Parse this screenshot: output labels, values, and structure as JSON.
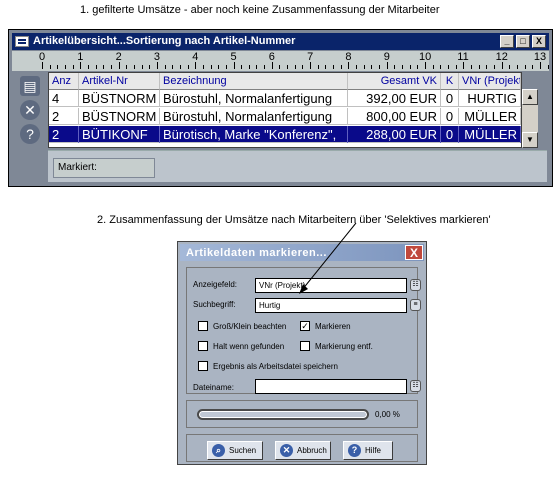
{
  "captions": {
    "top": "1.  gefilterte Umsätze - aber noch keine Zusammenfassung der Mitarbeiter",
    "bottom": "2. Zusammenfassung der Umsätze nach Mitarbeitern über 'Selektives markieren'"
  },
  "window": {
    "title": "Artikelübersicht...Sortierung nach Artikel-Nummer",
    "buttons": {
      "minimize": "_",
      "maximize": "□",
      "close": "X"
    },
    "ruler": [
      "0",
      "1",
      "2",
      "3",
      "4",
      "5",
      "6",
      "7",
      "8",
      "9",
      "10",
      "11",
      "12",
      "13"
    ],
    "sidebar_icons": [
      "printer-icon",
      "close-circle-icon",
      "help-circle-icon"
    ],
    "columns": [
      "Anz",
      "Artikel-Nr",
      "Bezeichnung",
      "Gesamt VK",
      "K",
      "VNr (Projekt"
    ],
    "rows": [
      {
        "anz": "4",
        "artikel": "BÜSTNORM",
        "bezeichnung": "Bürostuhl, Normalanfertigung",
        "gesamt": "392,00 EUR",
        "k": "0",
        "vnr": "HURTIG",
        "selected": false
      },
      {
        "anz": "2",
        "artikel": "BÜSTNORM",
        "bezeichnung": "Bürostuhl, Normalanfertigung",
        "gesamt": "800,00 EUR",
        "k": "0",
        "vnr": "MÜLLER",
        "selected": false
      },
      {
        "anz": "2",
        "artikel": "BÜTIKONF",
        "bezeichnung": "Bürotisch, Marke \"Konferenz\",",
        "gesamt": "288,00 EUR",
        "k": "0",
        "vnr": "MÜLLER",
        "selected": true
      }
    ],
    "mark_label": "Markiert:"
  },
  "dialog": {
    "title": "Artikeldaten markieren...",
    "close": "X",
    "anzeigefeld_label": "Anzeigefeld:",
    "anzeigefeld_value": "VNr (Projekt)",
    "suchbegriff_label": "Suchbegriff:",
    "suchbegriff_value": "Hurtig",
    "checkboxes": {
      "gross_klein": {
        "label": "Groß/Klein beachten",
        "checked": false
      },
      "markieren": {
        "label": "Markieren",
        "checked": true
      },
      "halt": {
        "label": "Halt wenn gefunden",
        "checked": false
      },
      "markierung_entf": {
        "label": "Markierung entf.",
        "checked": false
      },
      "ergebnis": {
        "label": "Ergebnis als Arbeitsdatei speichern",
        "checked": false
      }
    },
    "dateiname_label": "Dateiname:",
    "dateiname_value": "",
    "progress_text": "0,00 %",
    "progress": 0,
    "buttons": {
      "suchen": "Suchen",
      "abbruch": "Abbruch",
      "hilfe": "Hilfe"
    }
  },
  "colors": {
    "selection": "#0a0a8a",
    "titlebar": "#0a246a",
    "header_text": "#0000a0"
  }
}
